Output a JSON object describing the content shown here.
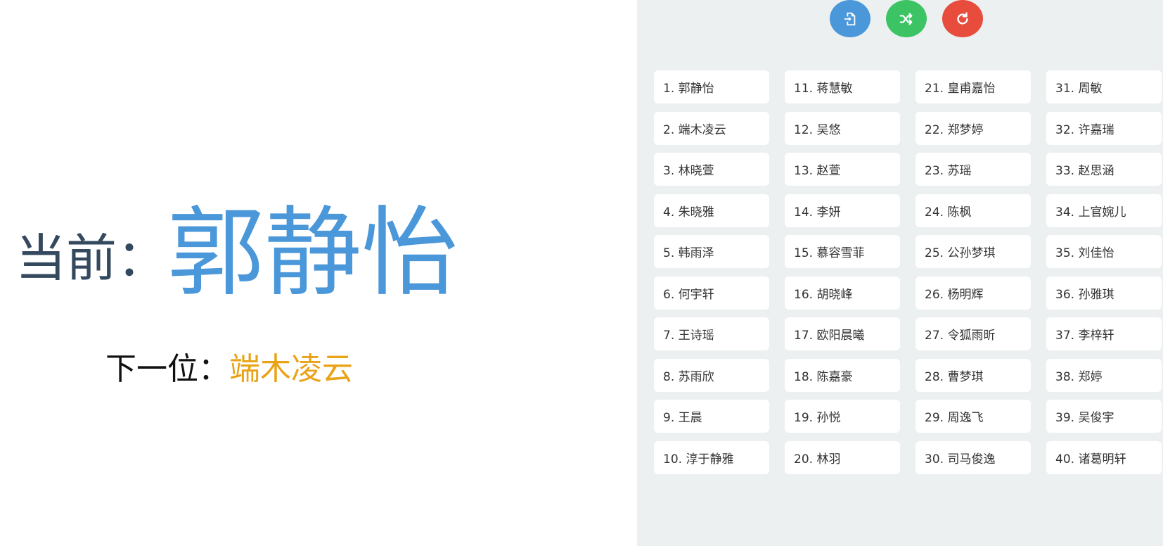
{
  "display": {
    "current_label": "当前：",
    "current_name": "郭静怡",
    "next_label": "下一位：",
    "next_name": "端木凌云"
  },
  "toolbar": {
    "buttons": [
      {
        "icon": "file-import-icon",
        "color": "#4a97d9"
      },
      {
        "icon": "shuffle-icon",
        "color": "#3cc464"
      },
      {
        "icon": "redo-icon",
        "color": "#e74c3c"
      }
    ]
  },
  "colors": {
    "current_name": "#4a97d9",
    "next_name": "#e8a317",
    "right_panel_bg": "#ecf0f1"
  },
  "names": [
    "1. 郭静怡",
    "2. 端木凌云",
    "3. 林晓萱",
    "4. 朱晓雅",
    "5. 韩雨泽",
    "6. 何宇轩",
    "7. 王诗瑶",
    "8. 苏雨欣",
    "9. 王晨",
    "10. 淳于静雅",
    "11. 蒋慧敏",
    "12. 吴悠",
    "13. 赵萱",
    "14. 李妍",
    "15. 慕容雪菲",
    "16. 胡晓峰",
    "17. 欧阳晨曦",
    "18. 陈嘉豪",
    "19. 孙悦",
    "20. 林羽",
    "21. 皇甫嘉怡",
    "22. 郑梦婷",
    "23. 苏瑶",
    "24. 陈枫",
    "25. 公孙梦琪",
    "26. 杨明辉",
    "27. 令狐雨昕",
    "28. 曹梦琪",
    "29. 周逸飞",
    "30. 司马俊逸",
    "31. 周敏",
    "32. 许嘉瑞",
    "33. 赵思涵",
    "34. 上官婉儿",
    "35. 刘佳怡",
    "36. 孙雅琪",
    "37. 李梓轩",
    "38. 郑婷",
    "39. 吴俊宇",
    "40. 诸葛明轩"
  ]
}
